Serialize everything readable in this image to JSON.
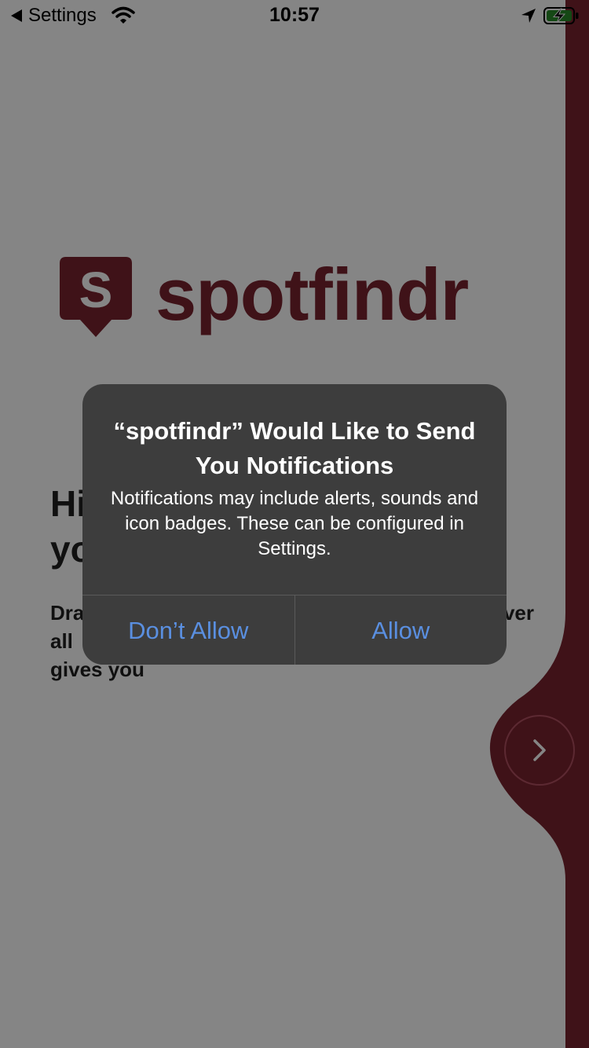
{
  "status_bar": {
    "back_label": "Settings",
    "time": "10:57"
  },
  "brand": {
    "name": "spotfindr",
    "badge_letter": "S",
    "color": "#7a242f"
  },
  "onboarding": {
    "heading_line1": "Hi",
    "heading_line2": "yo",
    "body_line1": "Dra",
    "body_line1_end": "ver",
    "body_line2": "all",
    "body_line3": "gives you"
  },
  "icons": {
    "back": "back-triangle-icon",
    "wifi": "wifi-icon",
    "location": "location-arrow-icon",
    "battery": "battery-charging-icon",
    "next": "chevron-right-icon"
  },
  "alert": {
    "title": "“spotfindr” Would Like to Send You Notifications",
    "message": "Notifications may include alerts, sounds and icon badges. These can be configured in Settings.",
    "deny_label": "Don’t Allow",
    "allow_label": "Allow",
    "button_color": "#5a8fe0"
  },
  "colors": {
    "accent": "#7a242f",
    "dim_background": "#848484",
    "alert_background": "#3d3d3d"
  }
}
